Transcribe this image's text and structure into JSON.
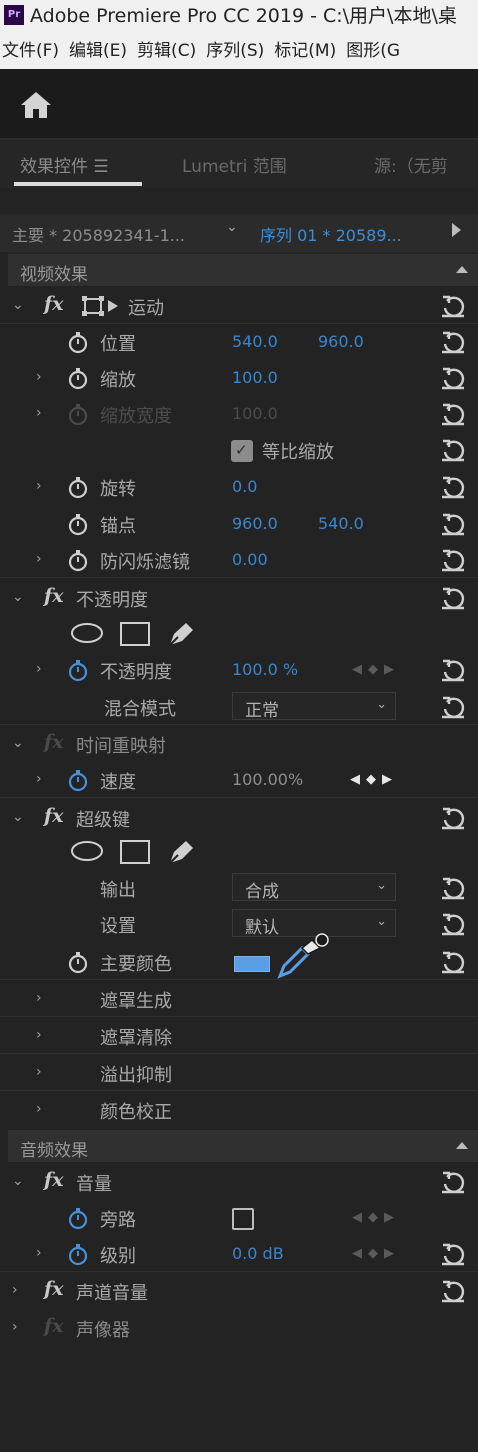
{
  "window": {
    "title": "Adobe Premiere Pro CC 2019 - C:\\用户\\本地\\桌",
    "app_badge": "Pr"
  },
  "menu": [
    "文件(F)",
    "编辑(E)",
    "剪辑(C)",
    "序列(S)",
    "标记(M)",
    "图形(G"
  ],
  "tabs": {
    "effects": "效果控件 ☰",
    "lumetri": "Lumetri 范围",
    "source": "源:（无剪"
  },
  "sequence": {
    "master": "主要 * 205892341-1...",
    "current": "序列 01 * 20589..."
  },
  "video_section": "视频效果",
  "motion": {
    "label": "运动",
    "position": {
      "label": "位置",
      "x": "540.0",
      "y": "960.0"
    },
    "scale": {
      "label": "缩放",
      "value": "100.0"
    },
    "scale_width": {
      "label": "缩放宽度",
      "value": "100.0"
    },
    "uniform_scale": {
      "label": "等比缩放",
      "checked": true
    },
    "rotation": {
      "label": "旋转",
      "value": "0.0"
    },
    "anchor": {
      "label": "锚点",
      "x": "960.0",
      "y": "540.0"
    },
    "antiflicker": {
      "label": "防闪烁滤镜",
      "value": "0.00"
    }
  },
  "opacity": {
    "label": "不透明度",
    "value_label": "不透明度",
    "value": "100.0 %",
    "blend_label": "混合模式",
    "blend_value": "正常"
  },
  "time_remap": {
    "label": "时间重映射",
    "speed_label": "速度",
    "speed_value": "100.00%"
  },
  "ultra_key": {
    "label": "超级键",
    "output_label": "输出",
    "output_value": "合成",
    "setting_label": "设置",
    "setting_value": "默认",
    "key_color_label": "主要颜色",
    "key_color": "#5a9fe6",
    "matte_gen": "遮罩生成",
    "matte_cleanup": "遮罩清除",
    "spill": "溢出抑制",
    "color_correct": "颜色校正"
  },
  "audio_section": "音频效果",
  "volume": {
    "label": "音量",
    "bypass_label": "旁路",
    "level_label": "级别",
    "level_value": "0.0 dB"
  },
  "channel_volume": "声道音量",
  "panner": "声像器",
  "colors": {
    "value_blue": "#3a86cf",
    "bg": "#232323",
    "accent": "#5a9fe6"
  }
}
